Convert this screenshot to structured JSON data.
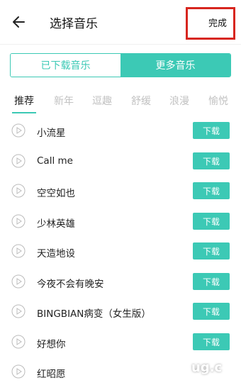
{
  "header": {
    "title": "选择音乐",
    "done_label": "完成"
  },
  "segments": [
    {
      "label": "已下载音乐",
      "active": false
    },
    {
      "label": "更多音乐",
      "active": true
    }
  ],
  "tabs": [
    "推荐",
    "新年",
    "逗趣",
    "舒缓",
    "浪漫",
    "愉悦"
  ],
  "songs": [
    "小流星",
    "Call me",
    "空空如也",
    "少林英雄",
    "天造地设",
    "今夜不会有晚安",
    "BINGBIAN病变（女生版）",
    "好想你",
    "红昭愿"
  ],
  "download_label": "下载",
  "watermark": "ug.c",
  "colors": {
    "accent": "#3cc9b5",
    "highlight_border": "#d7261f"
  }
}
